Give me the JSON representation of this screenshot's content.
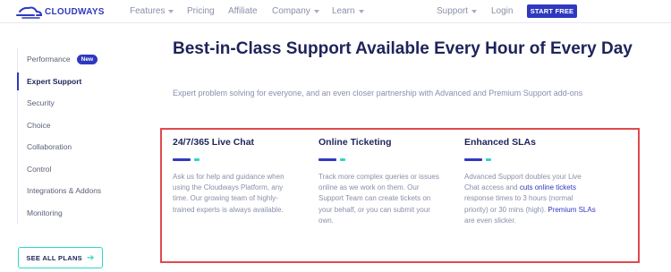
{
  "brand": {
    "name": "CLOUDWAYS",
    "logo_icon": "cloudways-logo-icon"
  },
  "nav": {
    "items": [
      {
        "label": "Features",
        "dropdown": true
      },
      {
        "label": "Pricing",
        "dropdown": false
      },
      {
        "label": "Affiliate",
        "dropdown": false
      },
      {
        "label": "Company",
        "dropdown": true
      },
      {
        "label": "Learn",
        "dropdown": true
      },
      {
        "label": "Support",
        "dropdown": true
      },
      {
        "label": "Login",
        "dropdown": false
      }
    ],
    "cta": "START FREE"
  },
  "sidebar": {
    "items": [
      {
        "label": "Performance",
        "badge": "New"
      },
      {
        "label": "Expert Support",
        "active": true
      },
      {
        "label": "Security"
      },
      {
        "label": "Choice"
      },
      {
        "label": "Collaboration"
      },
      {
        "label": "Control"
      },
      {
        "label": "Integrations & Addons"
      },
      {
        "label": "Monitoring"
      }
    ],
    "see_all": "SEE ALL PLANS",
    "see_all_icon": "arrow-right-icon"
  },
  "main": {
    "title": "Best-in-Class Support Available Every Hour of Every Day",
    "subtitle": "Expert problem solving for everyone, and an even closer partnership with Advanced and Premium Support add-ons",
    "columns": [
      {
        "title": "24/7/365 Live Chat",
        "body": "Ask us for help and guidance when using the Cloudways Platform, any time. Our growing team of highly-trained experts is always available."
      },
      {
        "title": "Online Ticketing",
        "body": "Track more complex queries or issues online as we work on them. Our Support Team can create tickets on your behalf, or you can submit your own."
      },
      {
        "title": "Enhanced SLAs",
        "body_1": "Advanced Support doubles your Live Chat access and ",
        "link_1": "cuts online tickets",
        "body_2": " response times to 3 hours (normal priority) or 30 mins (high). ",
        "link_2": "Premium SLAs",
        "body_3": " are even slicker."
      }
    ]
  },
  "colors": {
    "brand": "#2f39bf",
    "accent": "#2fd6c4",
    "highlight": "#e14a4a",
    "heading": "#1e2459",
    "muted": "#8a8fa8"
  }
}
